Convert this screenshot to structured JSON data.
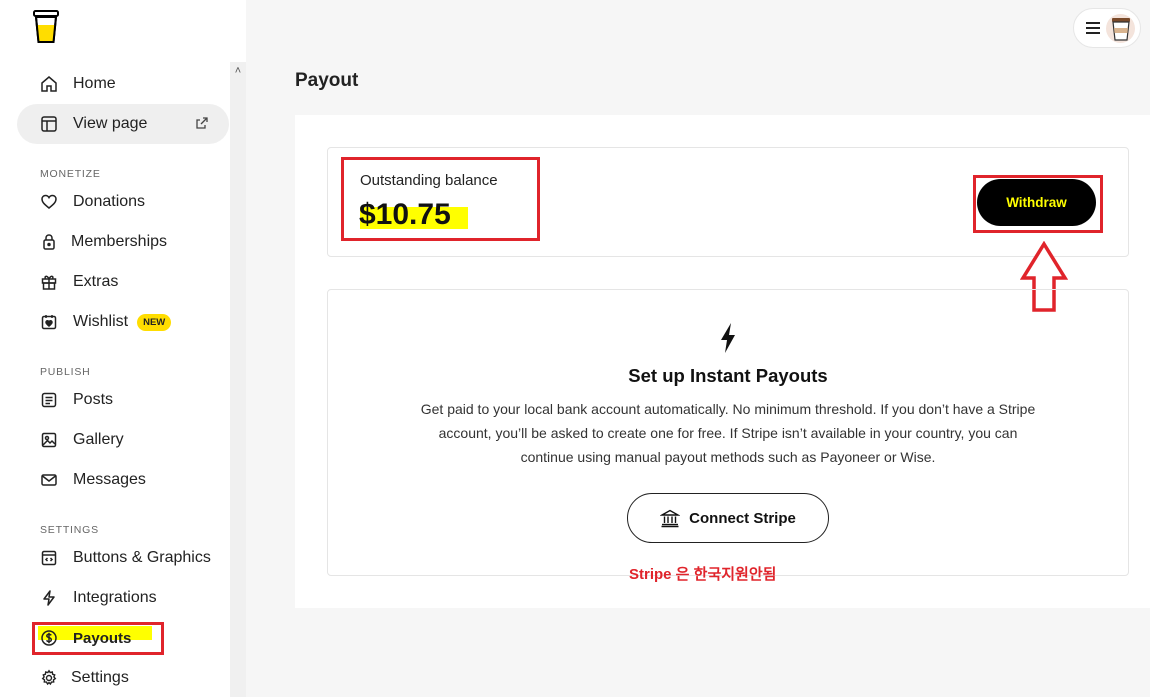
{
  "sidebar": {
    "home": "Home",
    "view_page": "View page",
    "sections": {
      "monetize": "MONETIZE",
      "publish": "PUBLISH",
      "settings": "SETTINGS"
    },
    "donations": "Donations",
    "memberships": "Memberships",
    "extras": "Extras",
    "wishlist": "Wishlist",
    "new_badge": "NEW",
    "posts": "Posts",
    "gallery": "Gallery",
    "messages": "Messages",
    "buttons_graphics": "Buttons & Graphics",
    "integrations": "Integrations",
    "payouts": "Payouts",
    "settings_item": "Settings"
  },
  "page": {
    "title": "Payout"
  },
  "balance": {
    "label": "Outstanding balance",
    "amount": "$10.75",
    "withdraw_label": "Withdraw"
  },
  "setup": {
    "title": "Set up Instant Payouts",
    "description": "Get paid to your local bank account automatically. No minimum threshold. If you don’t have a Stripe account, you’ll be asked to create one for free. If Stripe isn’t available in your country, you can continue using manual payout methods such as Payoneer or Wise.",
    "connect_label": "Connect Stripe",
    "note": "Stripe 은 한국지원안됨"
  },
  "colors": {
    "accent_yellow": "#ffdd00",
    "highlight_yellow": "#ffff00",
    "annotation_red": "#e0242b"
  },
  "icons": {
    "logo": "coffee-cup-logo",
    "home": "home-icon",
    "view_page": "layout-icon",
    "external": "external-link-icon",
    "donations": "heart-icon",
    "memberships": "lock-icon",
    "extras": "gift-icon",
    "wishlist": "calendar-heart-icon",
    "posts": "document-icon",
    "gallery": "image-icon",
    "messages": "mail-icon",
    "buttons_graphics": "code-window-icon",
    "integrations": "bolt-icon",
    "payouts": "dollar-circle-icon",
    "settings": "gear-icon",
    "bank": "bank-icon"
  }
}
